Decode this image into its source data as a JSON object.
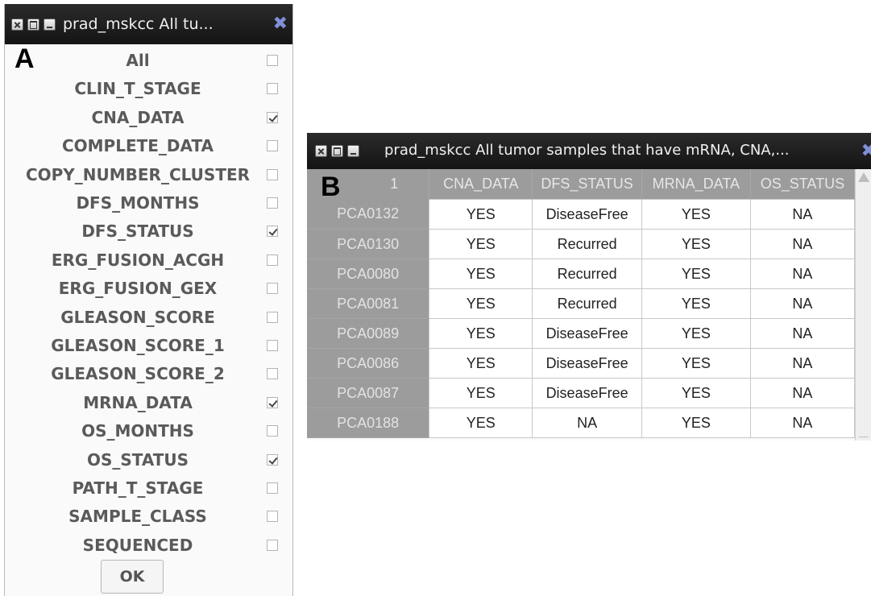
{
  "window_a": {
    "title": "prad_mskcc All tu...",
    "panel_letter": "A",
    "fields": [
      {
        "label": "All",
        "checked": false
      },
      {
        "label": "CLIN_T_STAGE",
        "checked": false
      },
      {
        "label": "CNA_DATA",
        "checked": true
      },
      {
        "label": "COMPLETE_DATA",
        "checked": false
      },
      {
        "label": "COPY_NUMBER_CLUSTER",
        "checked": false
      },
      {
        "label": "DFS_MONTHS",
        "checked": false
      },
      {
        "label": "DFS_STATUS",
        "checked": true
      },
      {
        "label": "ERG_FUSION_ACGH",
        "checked": false
      },
      {
        "label": "ERG_FUSION_GEX",
        "checked": false
      },
      {
        "label": "GLEASON_SCORE",
        "checked": false
      },
      {
        "label": "GLEASON_SCORE_1",
        "checked": false
      },
      {
        "label": "GLEASON_SCORE_2",
        "checked": false
      },
      {
        "label": "MRNA_DATA",
        "checked": true
      },
      {
        "label": "OS_MONTHS",
        "checked": false
      },
      {
        "label": "OS_STATUS",
        "checked": true
      },
      {
        "label": "PATH_T_STAGE",
        "checked": false
      },
      {
        "label": "SAMPLE_CLASS",
        "checked": false
      },
      {
        "label": "SEQUENCED",
        "checked": false
      }
    ],
    "ok_label": "OK"
  },
  "window_b": {
    "title": "prad_mskcc All tumor samples that have mRNA, CNA,...",
    "panel_letter": "B",
    "corner": "1",
    "columns": [
      "CNA_DATA",
      "DFS_STATUS",
      "MRNA_DATA",
      "OS_STATUS"
    ],
    "rows": [
      {
        "id": "PCA0132",
        "cells": [
          "YES",
          "DiseaseFree",
          "YES",
          "NA"
        ]
      },
      {
        "id": "PCA0130",
        "cells": [
          "YES",
          "Recurred",
          "YES",
          "NA"
        ]
      },
      {
        "id": "PCA0080",
        "cells": [
          "YES",
          "Recurred",
          "YES",
          "NA"
        ]
      },
      {
        "id": "PCA0081",
        "cells": [
          "YES",
          "Recurred",
          "YES",
          "NA"
        ]
      },
      {
        "id": "PCA0089",
        "cells": [
          "YES",
          "DiseaseFree",
          "YES",
          "NA"
        ]
      },
      {
        "id": "PCA0086",
        "cells": [
          "YES",
          "DiseaseFree",
          "YES",
          "NA"
        ]
      },
      {
        "id": "PCA0087",
        "cells": [
          "YES",
          "DiseaseFree",
          "YES",
          "NA"
        ]
      },
      {
        "id": "PCA0188",
        "cells": [
          "YES",
          "NA",
          "YES",
          "NA"
        ]
      }
    ]
  }
}
